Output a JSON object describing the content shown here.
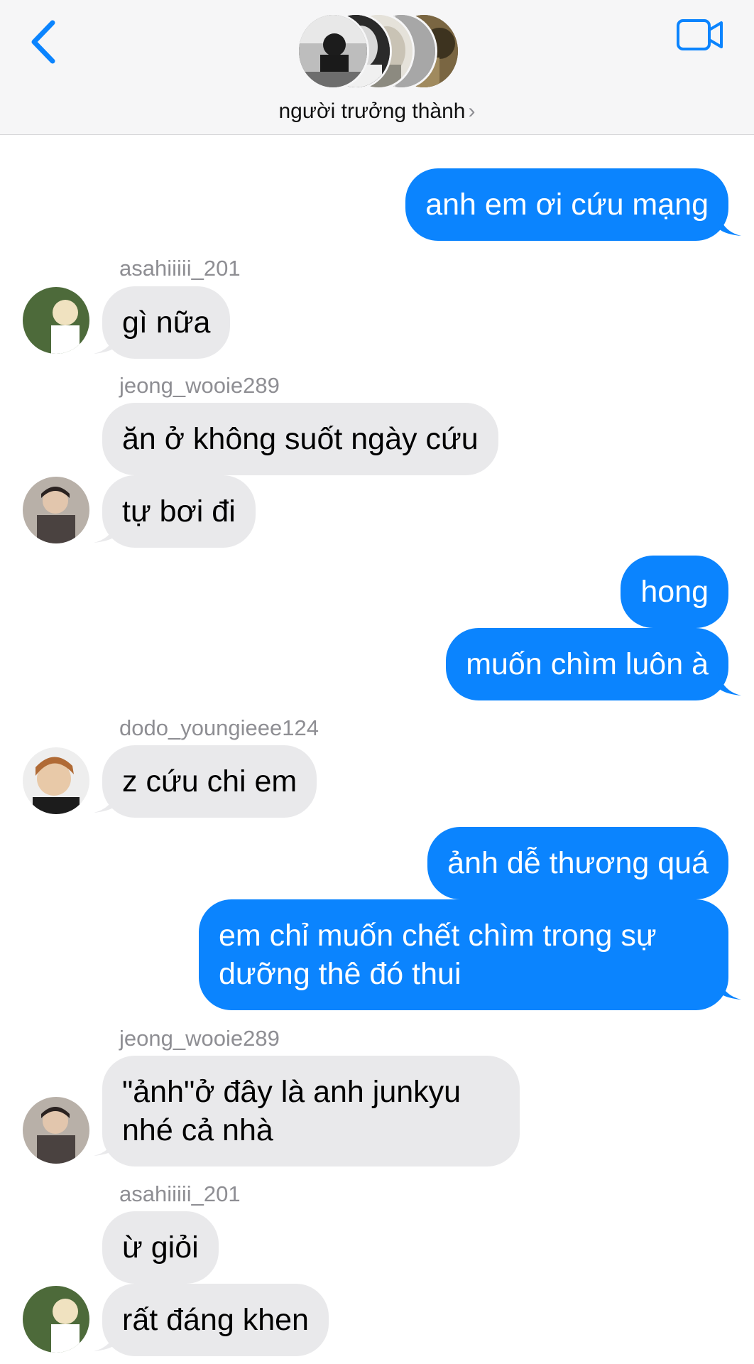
{
  "header": {
    "group_name": "người trưởng thành",
    "chevron": "›",
    "back_icon": "chevron-left-icon",
    "video_icon": "video-camera-icon",
    "accent_color": "#0b84fe"
  },
  "messages": [
    {
      "type": "out",
      "text": "anh em ơi cứu mạng"
    },
    {
      "type": "in",
      "sender": "asahiiiii_201",
      "text": "gì nữa"
    },
    {
      "type": "in",
      "sender": "jeong_wooie289",
      "text": "ăn ở không suốt ngày cứu"
    },
    {
      "type": "in",
      "text": "tự bơi đi"
    },
    {
      "type": "out",
      "text": "hong"
    },
    {
      "type": "out",
      "text": "muốn chìm luôn à"
    },
    {
      "type": "in",
      "sender": "dodo_youngieee124",
      "text": "z cứu chi em"
    },
    {
      "type": "out",
      "text": "ảnh dễ thương quá"
    },
    {
      "type": "out",
      "text": "em chỉ muốn chết chìm trong sự\ndưỡng thê đó thui"
    },
    {
      "type": "in",
      "sender": "jeong_wooie289",
      "text": "\"ảnh\"ở đây là anh junkyu\nnhé cả nhà"
    },
    {
      "type": "in",
      "sender": "asahiiiii_201",
      "text": "ừ giỏi"
    },
    {
      "type": "in",
      "text": "rất đáng khen"
    }
  ]
}
